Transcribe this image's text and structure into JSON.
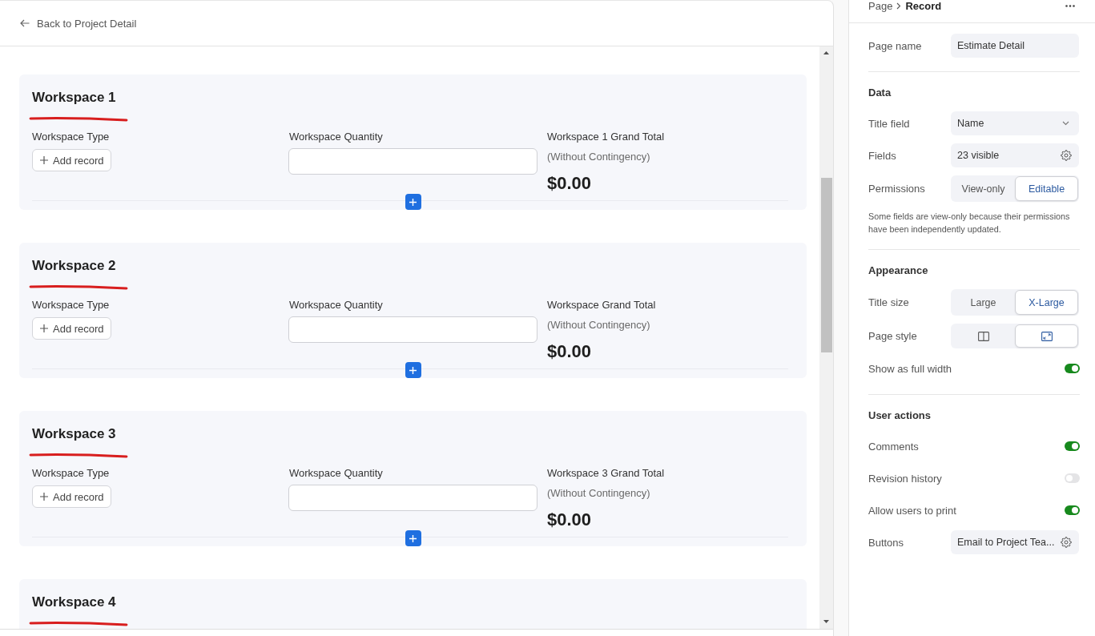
{
  "back_link": {
    "label": "Back to Project Detail"
  },
  "workspaces": [
    {
      "title": "Workspace 1",
      "annotated": true,
      "type_label": "Workspace Type",
      "add_label": "Add record",
      "quantity_label": "Workspace Quantity",
      "total_label": "Workspace 1 Grand Total",
      "total_note": "(Without Contingency)",
      "total_value": "$0.00"
    },
    {
      "title": "Workspace 2",
      "annotated": true,
      "type_label": "Workspace Type",
      "add_label": "Add record",
      "quantity_label": "Workspace Quantity",
      "total_label": "Workspace Grand Total",
      "total_note": "(Without Contingency)",
      "total_value": "$0.00"
    },
    {
      "title": "Workspace 3",
      "annotated": true,
      "type_label": "Workspace Type",
      "add_label": "Add record",
      "quantity_label": "Workspace Quantity",
      "total_label": "Workspace 3 Grand Total",
      "total_note": "(Without Contingency)",
      "total_value": "$0.00"
    },
    {
      "title": "Workspace 4",
      "annotated": true
    }
  ],
  "panel": {
    "breadcrumb": {
      "parent": "Page",
      "current": "Record"
    },
    "sections": [
      {
        "rows": [
          {
            "kind": "input",
            "label": "Page name",
            "value": "Estimate Detail"
          }
        ]
      },
      {
        "heading": "Data",
        "rows": [
          {
            "kind": "select",
            "label": "Title field",
            "value": "Name"
          },
          {
            "kind": "settings",
            "label": "Fields",
            "value": "23 visible"
          },
          {
            "kind": "segmented",
            "label": "Permissions",
            "options": [
              {
                "label": "View-only",
                "selected": false
              },
              {
                "label": "Editable",
                "selected": true
              }
            ]
          }
        ],
        "note": "Some fields are view-only because their permissions have been independently updated."
      },
      {
        "heading": "Appearance",
        "rows": [
          {
            "kind": "segmented",
            "label": "Title size",
            "options": [
              {
                "label": "Large",
                "selected": false
              },
              {
                "label": "X-Large",
                "selected": true
              }
            ]
          },
          {
            "kind": "segmented",
            "label": "Page style",
            "options": [
              {
                "kind": "split",
                "selected": false
              },
              {
                "kind": "expand",
                "selected": true
              }
            ]
          },
          {
            "kind": "toggle",
            "label": "Show as full width",
            "on": true
          }
        ]
      },
      {
        "heading": "User actions",
        "rows": [
          {
            "kind": "toggle",
            "label": "Comments",
            "on": true
          },
          {
            "kind": "toggle",
            "label": "Revision history",
            "on": false
          },
          {
            "kind": "toggle",
            "label": "Allow users to print",
            "on": true
          },
          {
            "kind": "settings",
            "label": "Buttons",
            "value": "Email to Project Tea..."
          }
        ]
      }
    ]
  }
}
